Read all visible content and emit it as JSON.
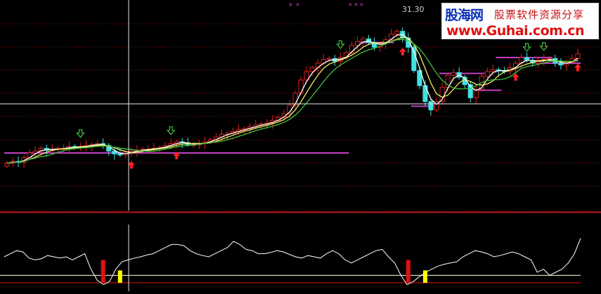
{
  "watermark": {
    "brand": "股海网",
    "tagline": "股票软件资源分享",
    "url": "www.Guhai.com.cn"
  },
  "colors": {
    "background": "#000000",
    "candle_up": "#e02020",
    "candle_down": "#40e0e0",
    "ma_fast": "#ffffff",
    "ma_mid": "#f0f060",
    "ma_slow": "#40c040",
    "support_line": "#c040c0",
    "buy_arrow": "#ff2020",
    "sell_arrow": "#40c040",
    "grid": "#7a1010",
    "indicator_line": "#ffffff",
    "indicator_level": "#ffffe0",
    "signal_red": "#e01010",
    "signal_yellow": "#ffff00"
  },
  "chart_data": [
    {
      "type": "candlestick",
      "title": "",
      "peak_label": "31.30",
      "ylim": [
        15,
        33
      ],
      "grid": true,
      "bars": 102,
      "close": [
        16.3,
        16.5,
        16.4,
        16.9,
        17.4,
        17.6,
        17.9,
        17.7,
        17.8,
        17.9,
        17.9,
        18.1,
        18.0,
        18.1,
        18.2,
        18.3,
        18.4,
        18.2,
        17.6,
        17.3,
        17.2,
        17.5,
        17.6,
        17.7,
        17.8,
        17.8,
        17.9,
        18.0,
        18.2,
        18.4,
        18.6,
        18.5,
        18.3,
        18.3,
        18.4,
        18.6,
        18.8,
        19.1,
        19.4,
        19.5,
        19.7,
        19.9,
        20.0,
        20.2,
        20.4,
        20.5,
        20.6,
        20.9,
        21.2,
        21.6,
        22.5,
        23.8,
        25.2,
        26.1,
        26.5,
        27.0,
        27.4,
        27.5,
        27.2,
        27.6,
        28.1,
        28.9,
        29.3,
        29.6,
        29.2,
        28.7,
        29.1,
        29.5,
        30.1,
        30.4,
        29.7,
        28.7,
        26.2,
        24.6,
        22.9,
        22.0,
        22.9,
        24.4,
        25.7,
        26.0,
        25.5,
        24.7,
        23.3,
        24.2,
        25.6,
        26.1,
        26.3,
        26.2,
        26.1,
        26.5,
        27.0,
        27.6,
        27.3,
        27.0,
        27.3,
        27.4,
        27.5,
        27.0,
        26.8,
        27.1,
        27.5,
        28.0
      ],
      "buy_signals_bar": [
        22,
        30,
        70,
        90,
        101
      ],
      "sell_signals_bar": [
        13,
        29,
        59,
        92,
        95
      ],
      "support_levels": [
        {
          "from_bar": 0,
          "to_bar": 60,
          "value": 17.4
        },
        {
          "from_bar": 63,
          "to_bar": 68,
          "value": 29.2
        },
        {
          "from_bar": 72,
          "to_bar": 76,
          "value": 22.4
        },
        {
          "from_bar": 77,
          "to_bar": 84,
          "value": 25.9
        },
        {
          "from_bar": 83,
          "to_bar": 87,
          "value": 24.1
        },
        {
          "from_bar": 87,
          "to_bar": 96,
          "value": 27.6
        },
        {
          "from_bar": 94,
          "to_bar": 101,
          "value": 27.0
        }
      ]
    },
    {
      "type": "line",
      "title": "",
      "ylim": [
        0,
        100
      ],
      "level": 20,
      "values": [
        50,
        55,
        60,
        58,
        48,
        45,
        47,
        52,
        50,
        48,
        50,
        45,
        50,
        55,
        30,
        12,
        5,
        10,
        30,
        42,
        45,
        48,
        50,
        53,
        55,
        60,
        65,
        70,
        70,
        68,
        60,
        55,
        52,
        50,
        55,
        60,
        65,
        75,
        70,
        62,
        60,
        55,
        55,
        57,
        60,
        58,
        54,
        50,
        48,
        52,
        50,
        48,
        55,
        60,
        55,
        45,
        40,
        45,
        50,
        55,
        60,
        62,
        50,
        40,
        20,
        5,
        10,
        18,
        25,
        30,
        35,
        38,
        40,
        42,
        50,
        55,
        60,
        58,
        55,
        50,
        52,
        55,
        58,
        55,
        50,
        45,
        25,
        30,
        20,
        25,
        30,
        40,
        55,
        80
      ],
      "signals": [
        {
          "bar": 17,
          "color": "red",
          "value": 45
        },
        {
          "bar": 20,
          "color": "yellow",
          "value": 28
        },
        {
          "bar": 71,
          "color": "red",
          "value": 45
        },
        {
          "bar": 74,
          "color": "yellow",
          "value": 28
        }
      ]
    }
  ]
}
